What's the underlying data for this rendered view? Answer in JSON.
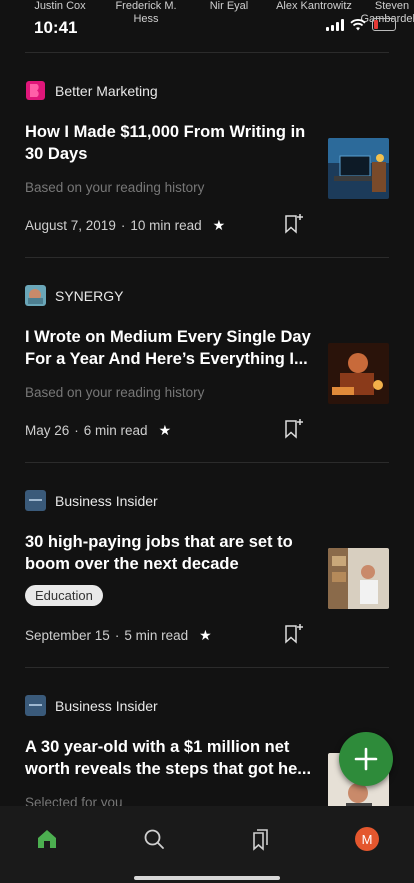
{
  "status_bar": {
    "time": "10:41",
    "authors": [
      "Justin Cox",
      "Frederick M. Hess",
      "Nir Eyal",
      "Alex Kantrowitz",
      "Steven Gambardello"
    ]
  },
  "feed": [
    {
      "publication": "Better Marketing",
      "title": "How I Made $11,000 From Writing in 30 Days",
      "reason": "Based on your reading history",
      "tag": "",
      "date": "August 7, 2019",
      "read_time": "10 min read",
      "logo_color": "#e0167a"
    },
    {
      "publication": "SYNERGY",
      "title": "I Wrote on Medium Every Single Day For a Year And Here’s Everything I...",
      "reason": "Based on your reading history",
      "tag": "",
      "date": "May 26",
      "read_time": "6 min read",
      "logo_color": "#6aa6b8"
    },
    {
      "publication": "Business Insider",
      "title": "30 high-paying jobs that are set to boom over the next decade",
      "reason": "",
      "tag": "Education",
      "date": "September 15",
      "read_time": "5 min read",
      "logo_color": "#3a5a7a"
    },
    {
      "publication": "Business Insider",
      "title": "A 30 year-old with a $1 million net worth reveals the steps that got he...",
      "reason": "Selected for you",
      "tag": "",
      "date": "",
      "read_time": "",
      "logo_color": "#3a5a7a"
    }
  ],
  "nav": {
    "items": [
      "home",
      "search",
      "bookmarks",
      "profile"
    ],
    "avatar_letter": "M",
    "accent": "#2e8b3a"
  },
  "separator": "·"
}
